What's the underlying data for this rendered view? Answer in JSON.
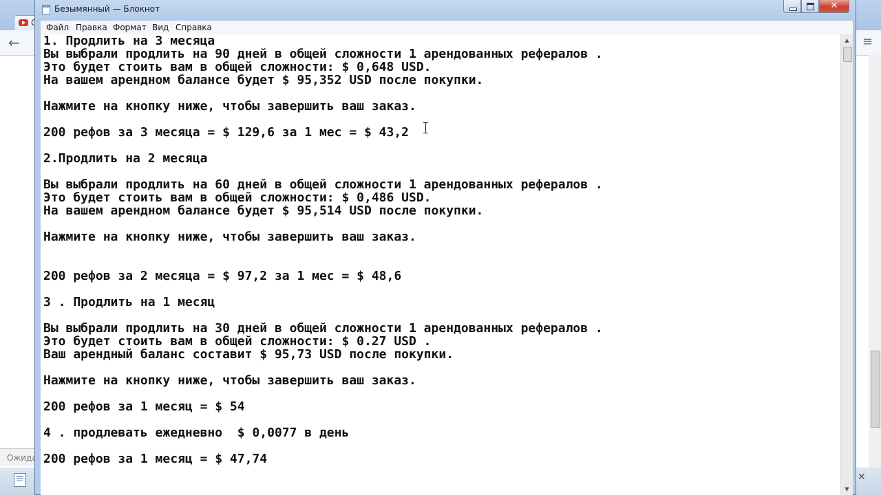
{
  "background_browser": {
    "tab_label": "С",
    "status_text": "Ожидан"
  },
  "notepad": {
    "title": "Безымянный — Блокнот",
    "caption_buttons": {
      "minimize": "",
      "maximize": "",
      "close": "✕"
    },
    "menu": [
      "Файл",
      "Правка",
      "Формат",
      "Вид",
      "Справка"
    ],
    "lines": [
      "1. Продлить на 3 месяца",
      "Вы выбрали продлить на 90 дней в общей сложности 1 арендованных рефералов .",
      "Это будет стоить вам в общей сложности: $ 0,648 USD.",
      "На вашем арендном балансе будет $ 95,352 USD после покупки.",
      "",
      "Нажмите на кнопку ниже, чтобы завершить ваш заказ.",
      "",
      "200 рефов за 3 месяца = $ 129,6 за 1 мес = $ 43,2",
      "",
      "2.Продлить на 2 месяца",
      "",
      "Вы выбрали продлить на 60 дней в общей сложности 1 арендованных рефералов .",
      "Это будет стоить вам в общей сложности: $ 0,486 USD.",
      "На вашем арендном балансе будет $ 95,514 USD после покупки.",
      "",
      "Нажмите на кнопку ниже, чтобы завершить ваш заказ.",
      "",
      "",
      "200 рефов за 2 месяца = $ 97,2 за 1 мес = $ 48,6",
      "",
      "3 . Продлить на 1 месяц",
      "",
      "Вы выбрали продлить на 30 дней в общей сложности 1 арендованных рефералов .",
      "Это будет стоить вам в общей сложности: $ 0.27 USD .",
      "Ваш арендный баланс составит $ 95,73 USD после покупки.",
      "",
      "Нажмите на кнопку ниже, чтобы завершить ваш заказ.",
      "",
      "200 рефов за 1 месяц = $ 54",
      "",
      "4 . продлевать ежедневно  $ 0,0077 в день",
      "",
      "200 рефов за 1 месяц = $ 47,74"
    ]
  }
}
